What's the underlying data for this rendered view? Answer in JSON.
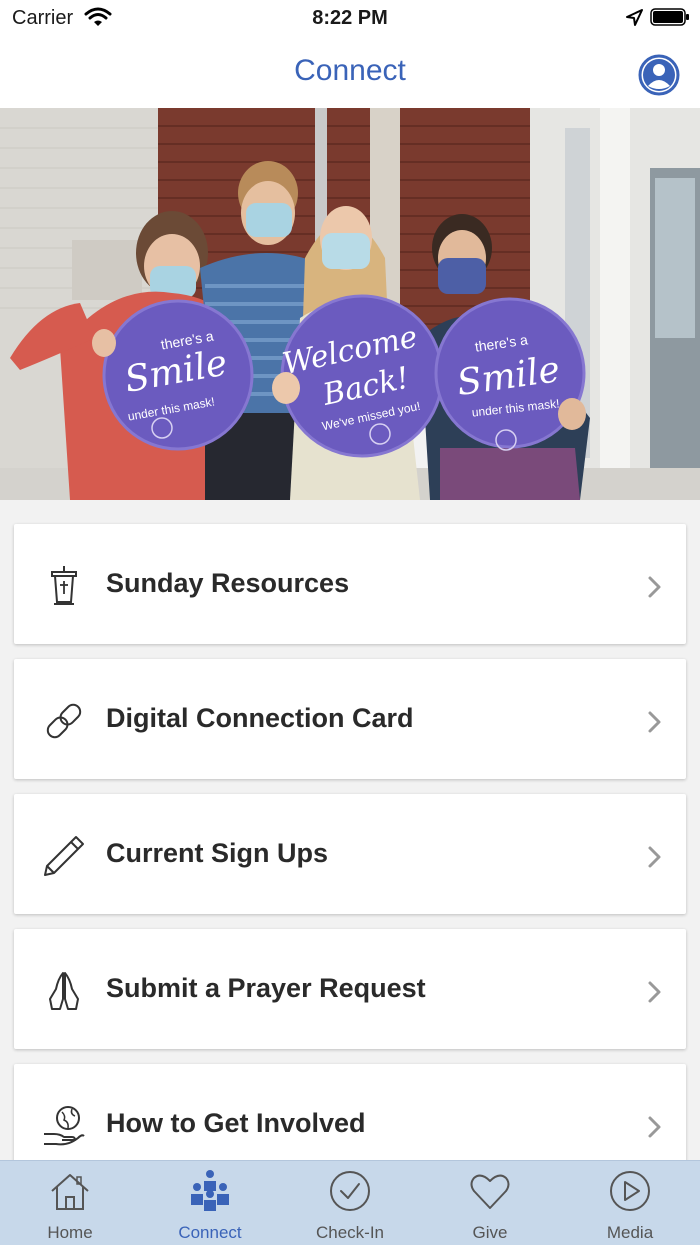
{
  "status_bar": {
    "carrier": "Carrier",
    "time": "8:22 PM"
  },
  "header": {
    "title": "Connect"
  },
  "hero": {
    "signs": [
      {
        "line1": "there's a",
        "line2": "Smile",
        "line3": "under this mask!"
      },
      {
        "line1": "Welcome",
        "line2": "Back!",
        "line3": "We've missed you!"
      },
      {
        "line1": "there's a",
        "line2": "Smile",
        "line3": "under this mask!"
      }
    ]
  },
  "menu": {
    "items": [
      {
        "label": "Sunday Resources",
        "icon": "podium-icon"
      },
      {
        "label": "Digital Connection Card",
        "icon": "link-icon"
      },
      {
        "label": "Current Sign Ups",
        "icon": "pencil-icon"
      },
      {
        "label": "Submit a Prayer Request",
        "icon": "praying-hands-icon"
      },
      {
        "label": "How to Get Involved",
        "icon": "globe-hand-icon"
      }
    ]
  },
  "tabs": [
    {
      "label": "Home",
      "icon": "home-icon",
      "active": false
    },
    {
      "label": "Connect",
      "icon": "people-icon",
      "active": true
    },
    {
      "label": "Check-In",
      "icon": "check-circle-icon",
      "active": false
    },
    {
      "label": "Give",
      "icon": "heart-icon",
      "active": false
    },
    {
      "label": "Media",
      "icon": "play-circle-icon",
      "active": false
    }
  ],
  "colors": {
    "accent": "#3a63b8",
    "tab_bar": "#c7d8ea",
    "sign": "#6b5bbf"
  }
}
